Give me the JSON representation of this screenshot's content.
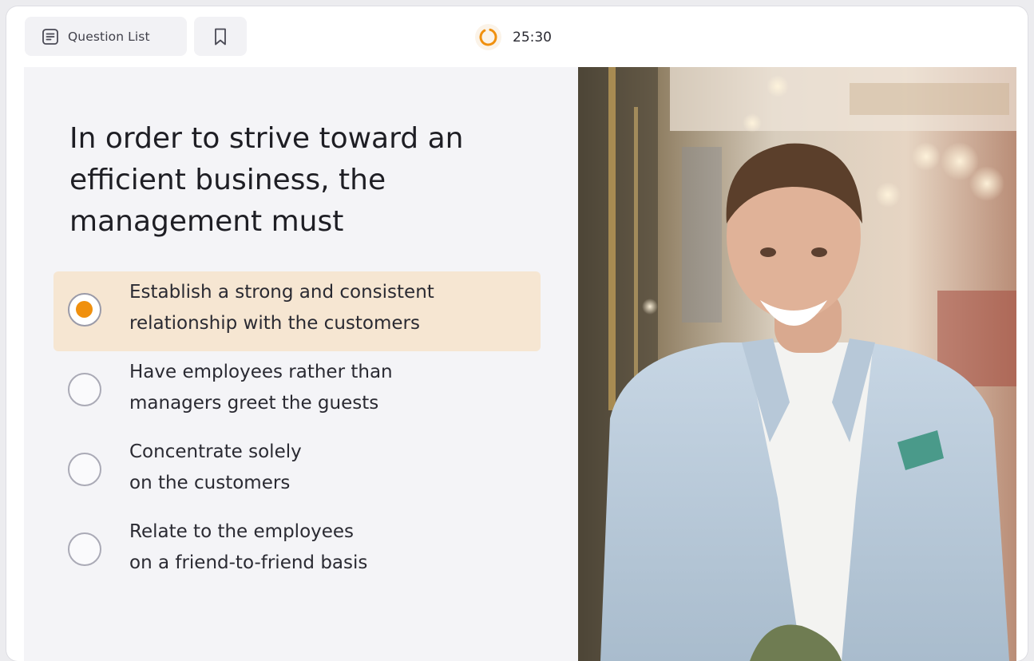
{
  "toolbar": {
    "question_list_label": "Question List",
    "question_list_icon": "list-document-icon",
    "bookmark_icon": "bookmark-icon",
    "timer_icon": "timer-ring-icon",
    "timer_value": "25:30"
  },
  "question": {
    "text": "In order to strive toward an efficient business, the management must",
    "selected_index": 0,
    "options": [
      {
        "line1": "Establish a strong and consistent",
        "line2": "relationship with the customers"
      },
      {
        "line1": "Have employees rather than",
        "line2": "managers greet the guests"
      },
      {
        "line1": "Concentrate solely",
        "line2": "on the customers"
      },
      {
        "line1": "Relate to the employees",
        "line2": "on a friend-to-friend basis"
      }
    ]
  },
  "colors": {
    "accent": "#f0900e",
    "selected_bg": "#f6e6d2",
    "panel_bg": "#f4f4f7"
  }
}
